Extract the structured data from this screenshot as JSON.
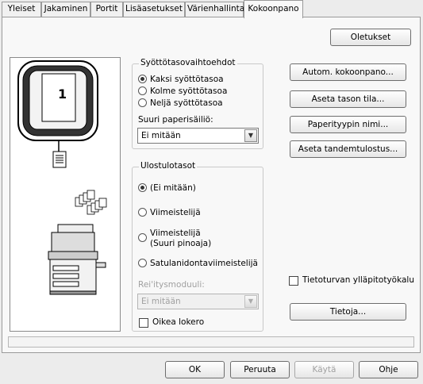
{
  "tabs": [
    "Yleiset",
    "Jakaminen",
    "Portit",
    "Lisäasetukset",
    "Värienhallinta",
    "Kokoonpano"
  ],
  "active_tab": "Kokoonpano",
  "buttons": {
    "defaults": "Oletukset",
    "auto_config": "Autom. kokoonpano...",
    "tray_status": "Aseta tason tila...",
    "paper_type_name": "Paperityypin nimi...",
    "tandem_output": "Aseta tandemtulostus...",
    "about": "Tietoja...",
    "ok": "OK",
    "cancel": "Peruuta",
    "apply": "Käytä",
    "help": "Ohje"
  },
  "preview": {
    "tray_number": "1"
  },
  "input_options": {
    "legend": "Syöttötasovaihtoehdot",
    "radios": [
      "Kaksi syöttötasoa",
      "Kolme syöttötasoa",
      "Neljä syöttötasoa"
    ],
    "selected_index": 0,
    "large_tray_label": "Suuri paperisäiliö:",
    "large_tray_value": "Ei mitään"
  },
  "output_trays": {
    "legend": "Ulostulotasot",
    "radio_none": "(Ei mitään)",
    "radio_finisher": "Viimeistelijä",
    "radio_finisher_large_line1": "Viimeistelijä",
    "radio_finisher_large_line2": "(Suuri pinoaja)",
    "radio_saddle": "Satulanidontaviimeistelijä",
    "punch_label": "Rei'itysmoduuli:",
    "punch_value": "Ei mitään",
    "right_tray_label": "Oikea lokero"
  },
  "security_tool_label": "Tietoturvan ylläpitotyökalu"
}
